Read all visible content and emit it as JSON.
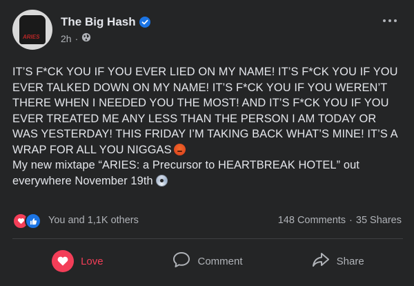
{
  "post": {
    "author": {
      "name": "The Big Hash",
      "avatar_text": "ARIES"
    },
    "meta": {
      "time": "2h",
      "separator": "·",
      "audience_icon": "globe-icon"
    },
    "body": {
      "paragraph_1": "IT’S F*CK YOU IF YOU EVER LIED ON MY NAME! IT’S F*CK YOU IF YOU EVER TALKED DOWN ON MY NAME! IT’S F*CK YOU IF YOU WEREN’T THERE WHEN I NEEDED YOU THE MOST! AND IT’S F*CK YOU IF YOU EVER TREATED ME ANY LESS THAN THE PERSON I AM TODAY OR WAS YESTERDAY! THIS FRIDAY I’M TAKING BACK WHAT’S MINE! IT’S A WRAP FOR ALL YOU NIGGAS",
      "paragraph_1_emoji": "angry-face-icon",
      "paragraph_2": "My new mixtape “ARIES: a Precursor to HEARTBREAK HOTEL” out everywhere November 19th",
      "paragraph_2_emoji": "optical-disc-icon"
    },
    "stats": {
      "reactions": "You and 1,1K others",
      "comments": "148 Comments",
      "separator": "·",
      "shares": "35 Shares"
    },
    "actions": {
      "love_label": "Love",
      "comment_label": "Comment",
      "share_label": "Share"
    },
    "colors": {
      "background": "#242526",
      "text": "#e4e6eb",
      "secondary_text": "#b0b3b8",
      "love": "#f33e58",
      "like_blue": "#1b74e4"
    }
  }
}
